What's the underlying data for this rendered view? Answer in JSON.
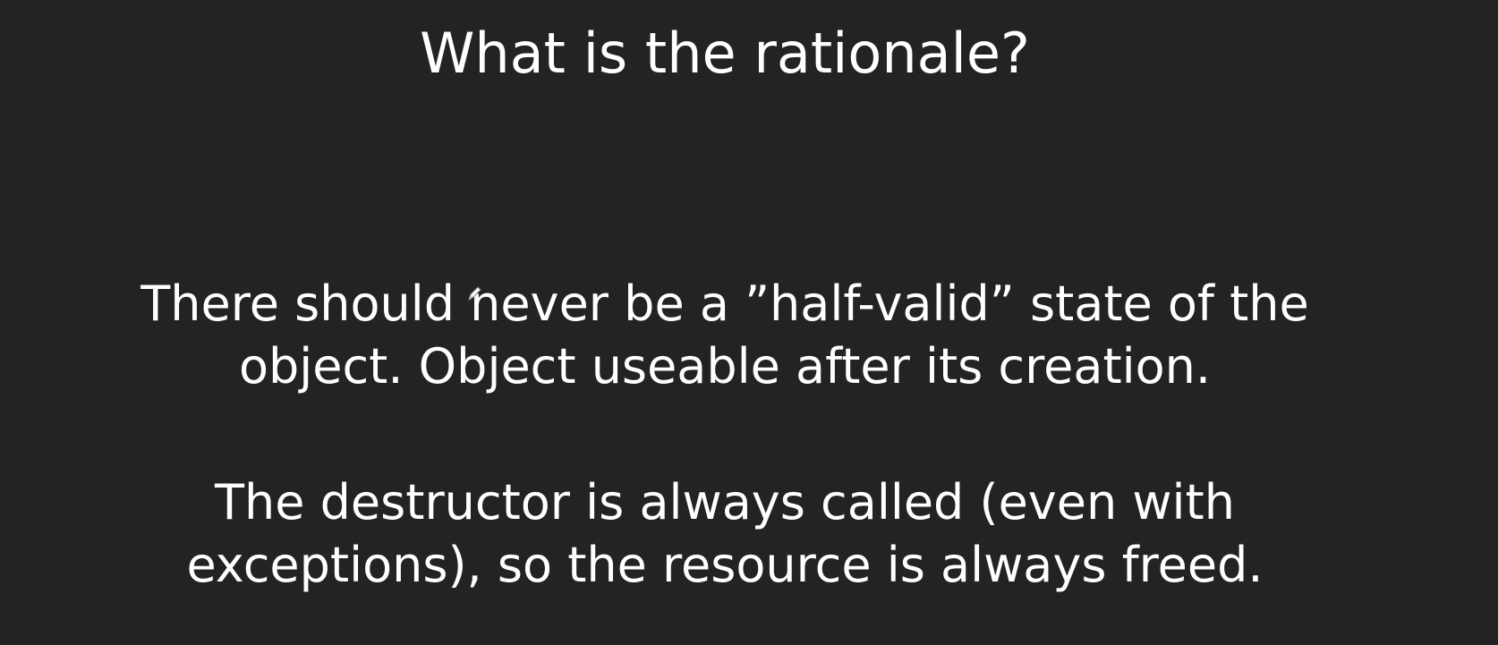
{
  "slide": {
    "title": "What is the rationale?",
    "paragraphs": [
      {
        "lines": [
          "There should never be a ”half-valid” state of the",
          "object. Object useable after its creation."
        ]
      },
      {
        "lines": [
          "The destructor is always called (even with",
          "exceptions), so the resource is always freed."
        ]
      }
    ],
    "cursor_icon": "pen-cursor-icon"
  },
  "colors": {
    "background": "#232323",
    "text": "#ffffff"
  }
}
